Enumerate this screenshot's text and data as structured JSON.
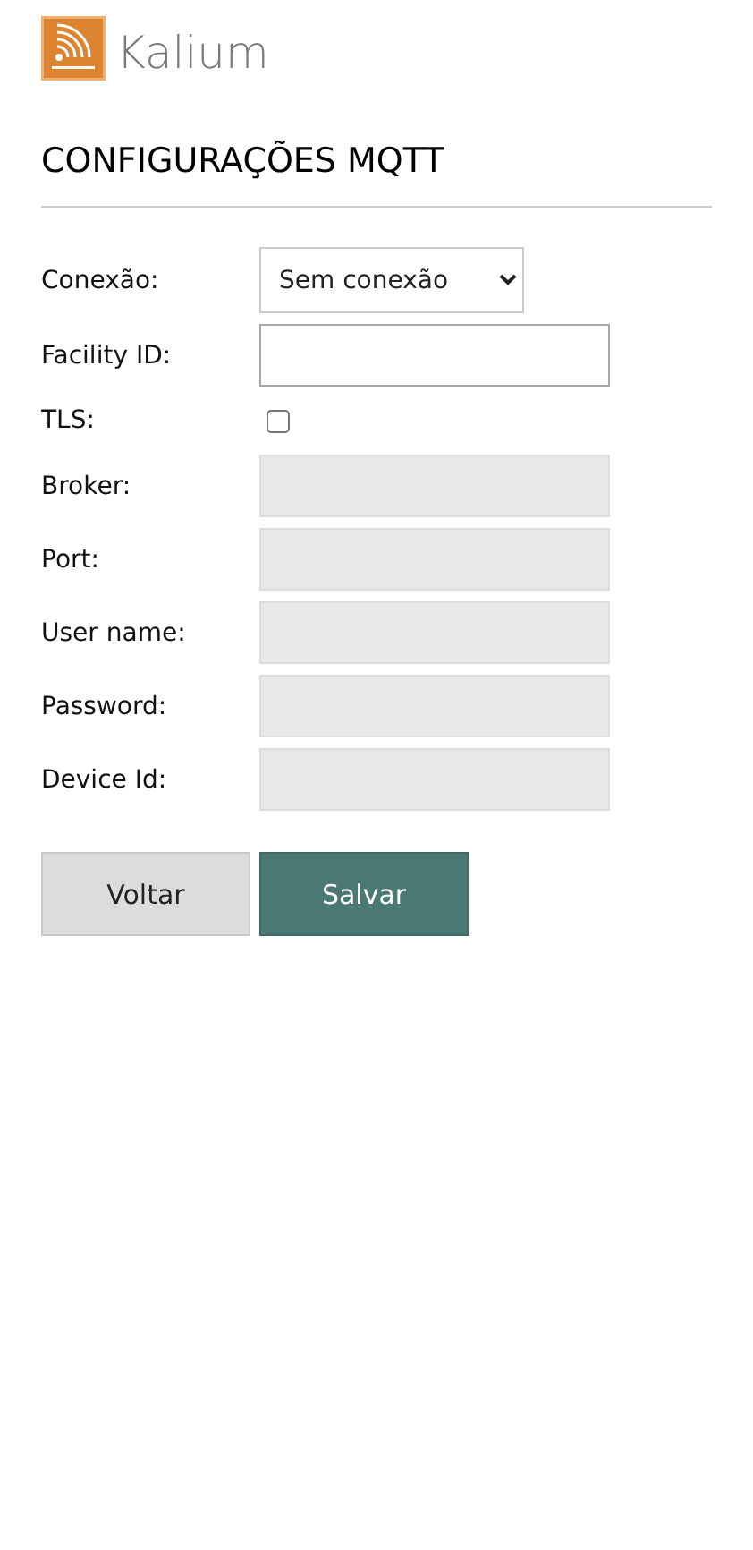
{
  "brand": {
    "name": "Kalium"
  },
  "title": "CONFIGURAÇÕES MQTT",
  "fields": [
    {
      "kind": "select",
      "label": "Conexão:",
      "value": "Sem conexão",
      "disabled": false
    },
    {
      "kind": "text",
      "label": "Facility ID:",
      "disabled": false
    },
    {
      "kind": "checkbox",
      "label": "TLS:",
      "checked": false,
      "disabled": false
    },
    {
      "kind": "text",
      "label": "Broker:",
      "disabled": true
    },
    {
      "kind": "text",
      "label": "Port:",
      "disabled": true
    },
    {
      "kind": "text",
      "label": "User name:",
      "disabled": true
    },
    {
      "kind": "text",
      "label": "Password:",
      "disabled": true
    },
    {
      "kind": "text",
      "label": "Device Id:",
      "disabled": true
    }
  ],
  "buttons": [
    {
      "label": "Voltar",
      "kind": "secondary"
    },
    {
      "label": "Salvar",
      "kind": "primary"
    }
  ]
}
